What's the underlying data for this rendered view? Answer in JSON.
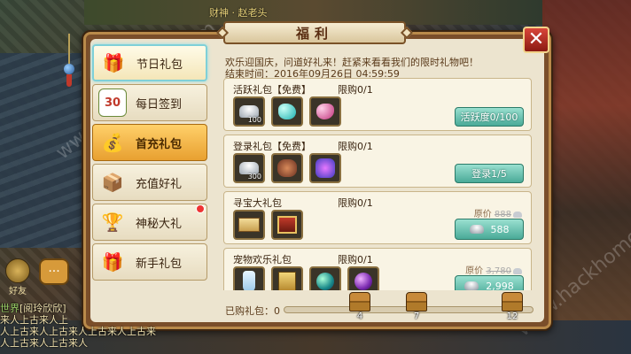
{
  "top_name": "财神 · 赵老头",
  "panel": {
    "title": "福利",
    "close_glyph": "✕"
  },
  "sidebar": {
    "items": [
      {
        "label": "节日礼包",
        "icon": "gift-box-icon",
        "glyph": "🎁",
        "state": "active"
      },
      {
        "label": "每日签到",
        "icon": "calendar-icon",
        "glyph": "30",
        "state": "normal"
      },
      {
        "label": "首充礼包",
        "icon": "money-bag-icon",
        "glyph": "💰",
        "state": "selected"
      },
      {
        "label": "充值好礼",
        "icon": "treasure-chest-icon",
        "glyph": "📦",
        "state": "normal"
      },
      {
        "label": "神秘大礼",
        "icon": "golden-chest-icon",
        "glyph": "🏆",
        "state": "normal",
        "badge": true
      },
      {
        "label": "新手礼包",
        "icon": "present-icon",
        "glyph": "🎁",
        "state": "normal"
      }
    ]
  },
  "info": {
    "line1": "欢乐迎国庆，问道好礼来！赶紧来看看我们的限时礼物吧！",
    "line2": "结束时间：2016年09月26日 04:59:59"
  },
  "packs": [
    {
      "name": "活跃礼包【免费】",
      "limit": "限购0/1",
      "items": [
        {
          "icon": "silver-ingot-icon",
          "count": "100"
        },
        {
          "icon": "cyan-gem-icon",
          "count": ""
        },
        {
          "icon": "pink-gem-icon",
          "count": ""
        }
      ],
      "button": "活跃度0/100",
      "kind": "claim"
    },
    {
      "name": "登录礼包【免费】",
      "limit": "限购0/1",
      "items": [
        {
          "icon": "silver-ingot-icon",
          "count": "300"
        },
        {
          "icon": "beast-icon",
          "count": ""
        },
        {
          "icon": "mask-icon",
          "count": ""
        }
      ],
      "button": "登录1/5",
      "kind": "claim"
    },
    {
      "name": "寻宝大礼包",
      "limit": "限购0/1",
      "items": [
        {
          "icon": "scroll-icon",
          "count": ""
        },
        {
          "icon": "red-box-icon",
          "count": ""
        }
      ],
      "orig_label": "原价",
      "orig_price": "888",
      "button": "588",
      "kind": "buy"
    },
    {
      "name": "宠物欢乐礼包",
      "limit": "限购0/1",
      "items": [
        {
          "icon": "bottle-icon",
          "count": ""
        },
        {
          "icon": "book-icon",
          "count": ""
        },
        {
          "icon": "green-orb-icon",
          "count": ""
        },
        {
          "icon": "purple-orb-icon",
          "count": ""
        }
      ],
      "orig_label": "原价",
      "orig_price": "3,780",
      "button": "2,998",
      "kind": "buy"
    }
  ],
  "progress": {
    "label": "已购礼包：0",
    "fraction": 0,
    "milestones": [
      "4",
      "7",
      "12"
    ]
  },
  "chat": {
    "friend_label": "好友",
    "lines": [
      {
        "channel": "世界",
        "text": "[阅玲欣欣]"
      },
      {
        "channel": "",
        "text": "来人上古来人上"
      },
      {
        "channel": "",
        "text": "人上古来人上古来人上古来人上古来"
      },
      {
        "channel": "",
        "text": "人上古来人上古来人"
      }
    ]
  },
  "watermark": "www.hackhome.com"
}
